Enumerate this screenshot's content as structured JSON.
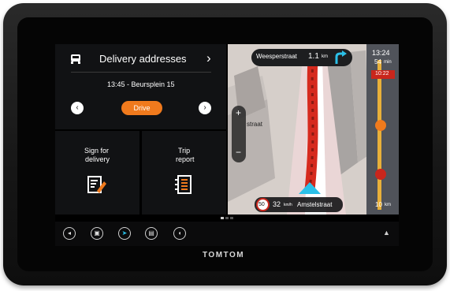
{
  "delivery": {
    "title": "Delivery addresses",
    "next_arrow": "›",
    "stop": "13:45 - Beursplein 15",
    "prev_label": "‹",
    "next_label": "›",
    "drive_label": "Drive"
  },
  "tiles": {
    "sign_line1": "Sign for",
    "sign_line2": "delivery",
    "trip_line1": "Trip",
    "trip_line2": "report"
  },
  "map": {
    "street_top": "Weesperstraat",
    "distance_top": "1.1",
    "distance_unit": "km",
    "clock": "13:24",
    "eta_minutes": "54",
    "eta_unit": "min",
    "arrival_badge": "10:22",
    "zoom_in": "+",
    "zoom_out": "−",
    "side_street": "straat",
    "speed_limit": "50",
    "current_speed": "32",
    "speed_unit": "km/h",
    "current_street": "Amstelstraat",
    "bottom_dist": "10",
    "bottom_unit": "km"
  },
  "bottombar": {
    "items": [
      "back-icon",
      "menu-icon",
      "navigate-icon",
      "truck-icon",
      "sound-icon"
    ],
    "expand": "▲"
  },
  "brand": "TOMTOM",
  "colors": {
    "accent": "#f07a1d",
    "route": "#d62a1e",
    "panel": "#111214"
  }
}
